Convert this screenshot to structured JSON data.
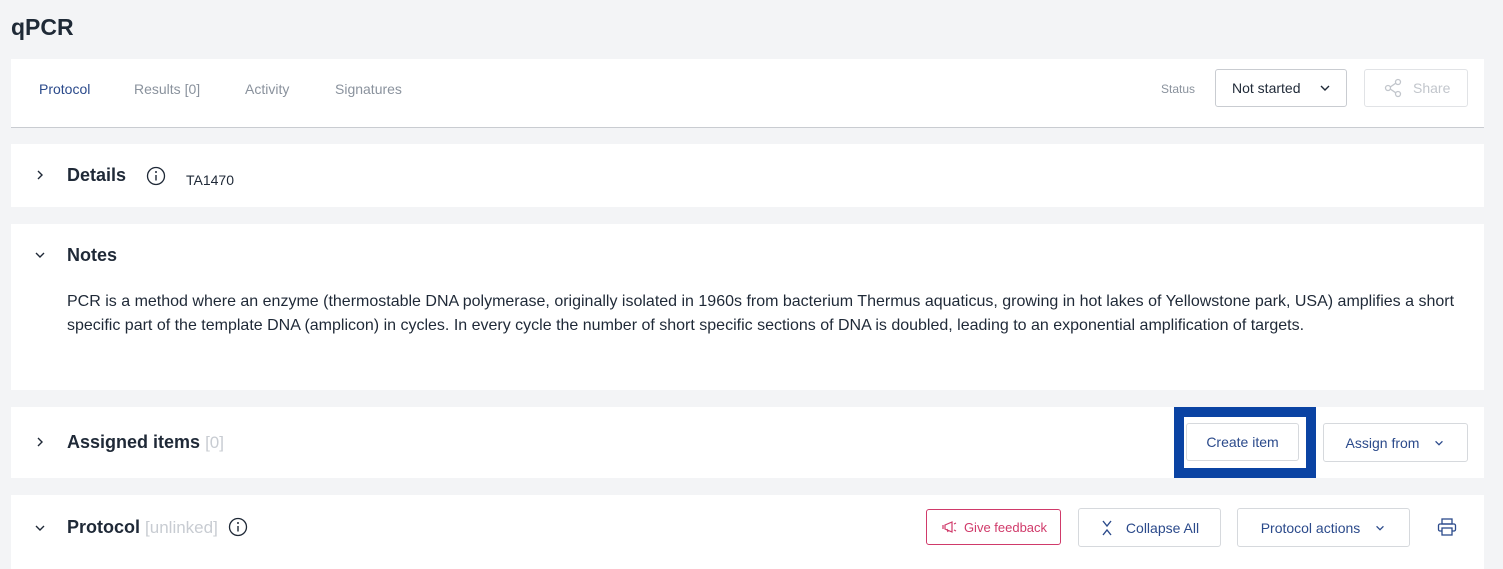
{
  "page_title": "qPCR",
  "tabs": [
    {
      "label": "Protocol"
    },
    {
      "label": "Results [0]"
    },
    {
      "label": "Activity"
    },
    {
      "label": "Signatures"
    }
  ],
  "status": {
    "label": "Status",
    "value": "Not started"
  },
  "share_label": "Share",
  "details": {
    "title": "Details",
    "code": "TA1470"
  },
  "notes": {
    "title": "Notes",
    "text": "PCR is a method where an enzyme (thermostable DNA polymerase, originally isolated in 1960s from bacterium Thermus aquaticus, growing in hot lakes of Yellowstone park, USA) amplifies a short specific part of the template DNA (amplicon) in cycles. In every cycle the number of short specific sections of DNA is doubled, leading to an exponential amplification of targets."
  },
  "assigned": {
    "title": "Assigned items",
    "count": "[0]",
    "create_label": "Create item",
    "assign_label": "Assign from"
  },
  "protocol": {
    "title": "Protocol",
    "state": "[unlinked]",
    "feedback_label": "Give feedback",
    "collapse_label": "Collapse All",
    "actions_label": "Protocol actions"
  },
  "colors": {
    "accent": "#2b4a8b",
    "highlight": "#0a43a3",
    "feedback": "#d03a6a"
  }
}
